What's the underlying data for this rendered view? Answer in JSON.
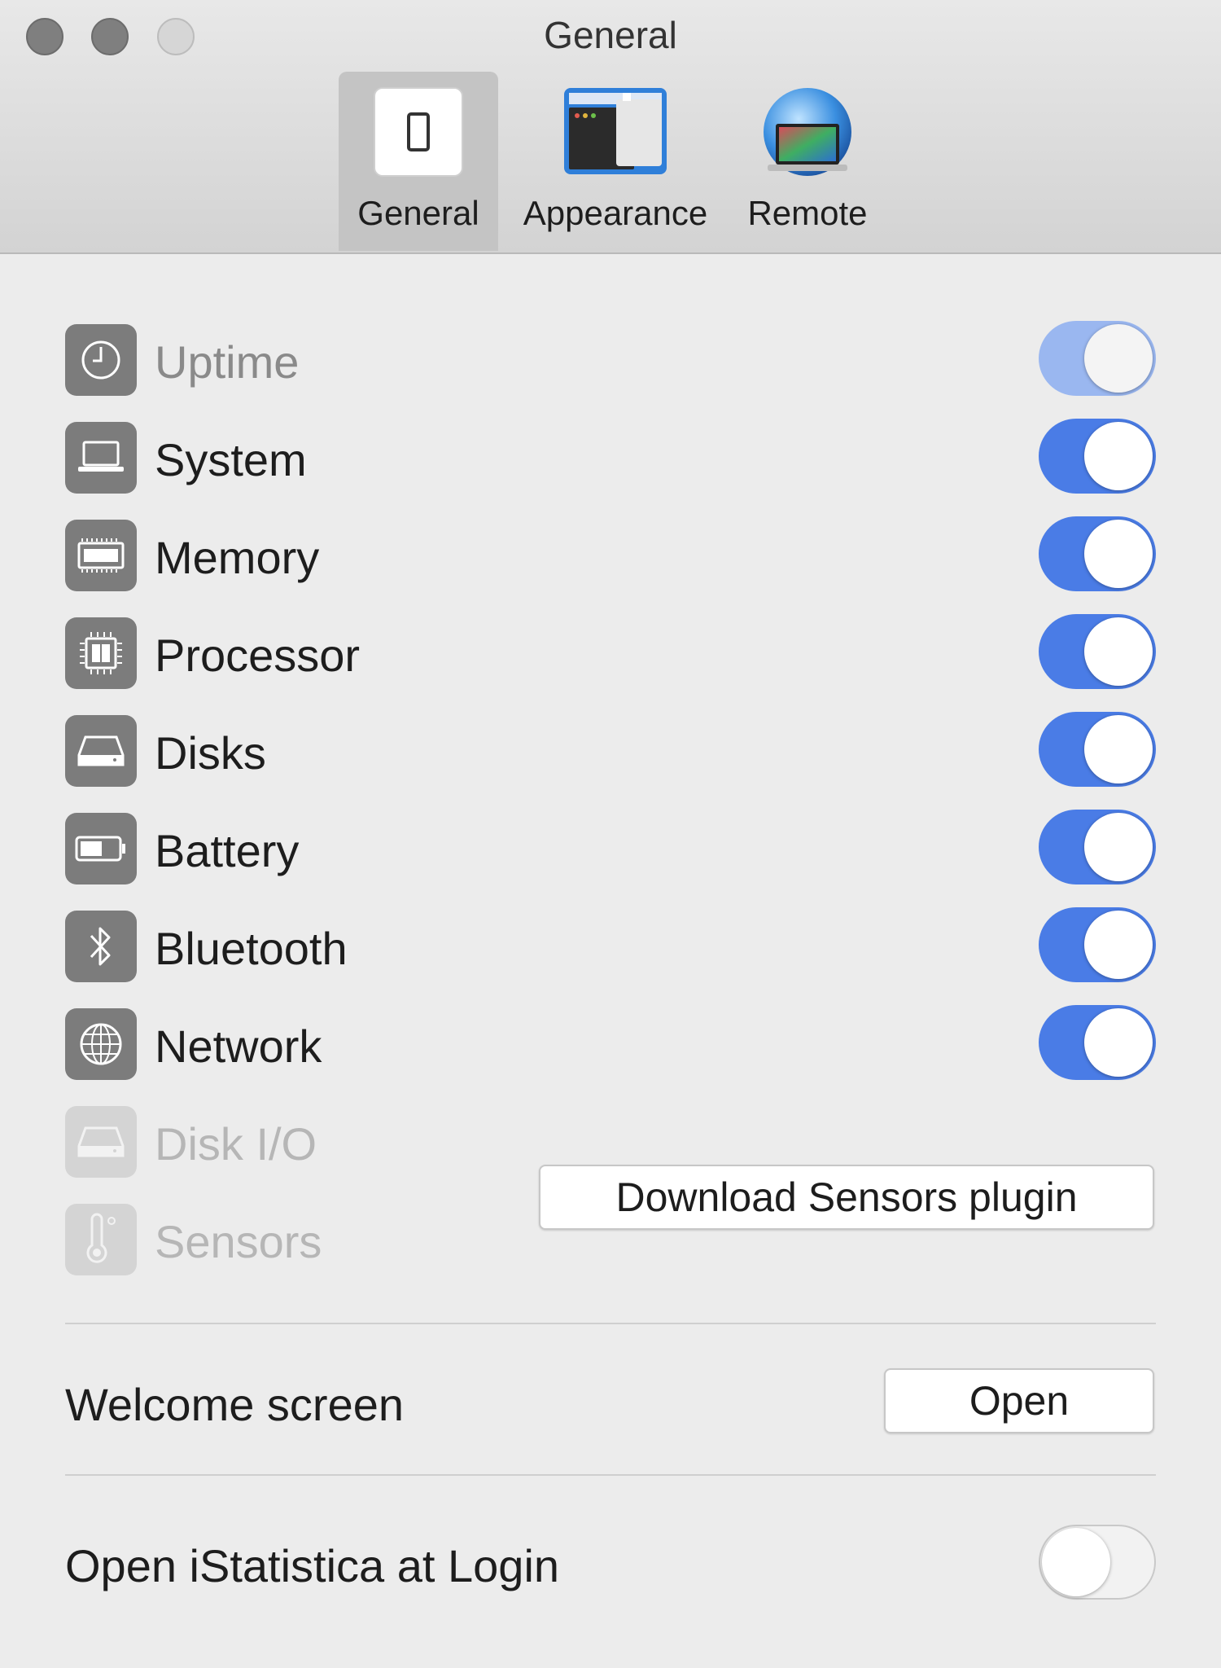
{
  "window": {
    "title": "General"
  },
  "tabs": [
    {
      "label": "General",
      "icon": "switch-icon",
      "selected": true
    },
    {
      "label": "Appearance",
      "icon": "window-icon",
      "selected": false
    },
    {
      "label": "Remote",
      "icon": "globe-laptop-icon",
      "selected": false
    }
  ],
  "modules": [
    {
      "label": "Uptime",
      "icon": "clock-icon",
      "enabled": true,
      "state": "disabled"
    },
    {
      "label": "System",
      "icon": "laptop-icon",
      "enabled": true,
      "state": "normal"
    },
    {
      "label": "Memory",
      "icon": "memory-icon",
      "enabled": true,
      "state": "normal"
    },
    {
      "label": "Processor",
      "icon": "processor-icon",
      "enabled": true,
      "state": "normal"
    },
    {
      "label": "Disks",
      "icon": "disk-icon",
      "enabled": true,
      "state": "normal"
    },
    {
      "label": "Battery",
      "icon": "battery-icon",
      "enabled": true,
      "state": "normal"
    },
    {
      "label": "Bluetooth",
      "icon": "bluetooth-icon",
      "enabled": true,
      "state": "normal"
    },
    {
      "label": "Network",
      "icon": "globe-icon",
      "enabled": true,
      "state": "normal"
    },
    {
      "label": "Disk I/O",
      "icon": "disk-icon",
      "state": "unavailable"
    },
    {
      "label": "Sensors",
      "icon": "thermometer-icon",
      "state": "unavailable"
    }
  ],
  "sensors_button": {
    "label": "Download Sensors plugin"
  },
  "welcome": {
    "label": "Welcome screen",
    "button": "Open"
  },
  "login": {
    "label": "Open iStatistica at Login",
    "enabled": false
  },
  "colors": {
    "accent": "#4a7ce6",
    "toolbar": "#d8d8d8",
    "background": "#ececec"
  }
}
